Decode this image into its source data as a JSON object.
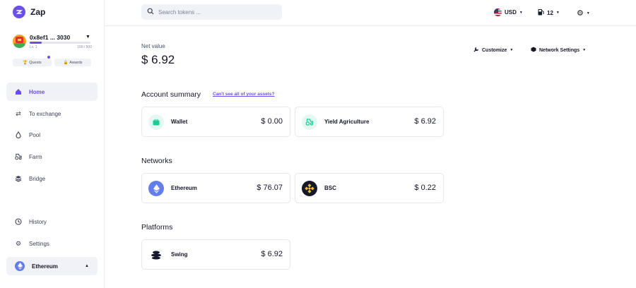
{
  "app": {
    "name": "Zap",
    "brand_color": "#6b4ef0"
  },
  "account": {
    "address": "0x8ef1 ... 3030",
    "level": "Lv. 1",
    "xp": "100 / 500",
    "progress": 0.2
  },
  "pills": {
    "quests": "Quests",
    "awards": "Awards"
  },
  "nav": {
    "home": "Home",
    "exchange": "To exchange",
    "pool": "Pool",
    "farm": "Farm",
    "bridge": "Bridge",
    "history": "History",
    "settings": "Settings",
    "network": "Ethereum"
  },
  "header": {
    "search_placeholder": "Search tokens ...",
    "currency": "USD",
    "gas": "12"
  },
  "main": {
    "net_value_label": "Net value",
    "net_value": "$ 6.92",
    "customize": "Customize",
    "network_settings": "Network Settings",
    "account_summary": {
      "title": "Account summary",
      "link": "Can't see all of your assets?",
      "cards": [
        {
          "name": "Wallet",
          "value": "$ 0.00",
          "icon": "wallet-icon",
          "color": "#20c997"
        },
        {
          "name": "Yield Agriculture",
          "value": "$ 6.92",
          "icon": "tractor-icon",
          "color": "#20c997"
        }
      ]
    },
    "networks": {
      "title": "Networks",
      "cards": [
        {
          "name": "Ethereum",
          "value": "$ 76.07",
          "icon": "ethereum-icon",
          "color": "#627eea"
        },
        {
          "name": "BSC",
          "value": "$ 0.22",
          "icon": "bsc-icon",
          "color": "#f3ba2f"
        }
      ]
    },
    "platforms": {
      "title": "Platforms",
      "cards": [
        {
          "name": "Swing",
          "value": "$ 6.92",
          "icon": "swing-icon",
          "color": "#15172a"
        }
      ]
    }
  }
}
